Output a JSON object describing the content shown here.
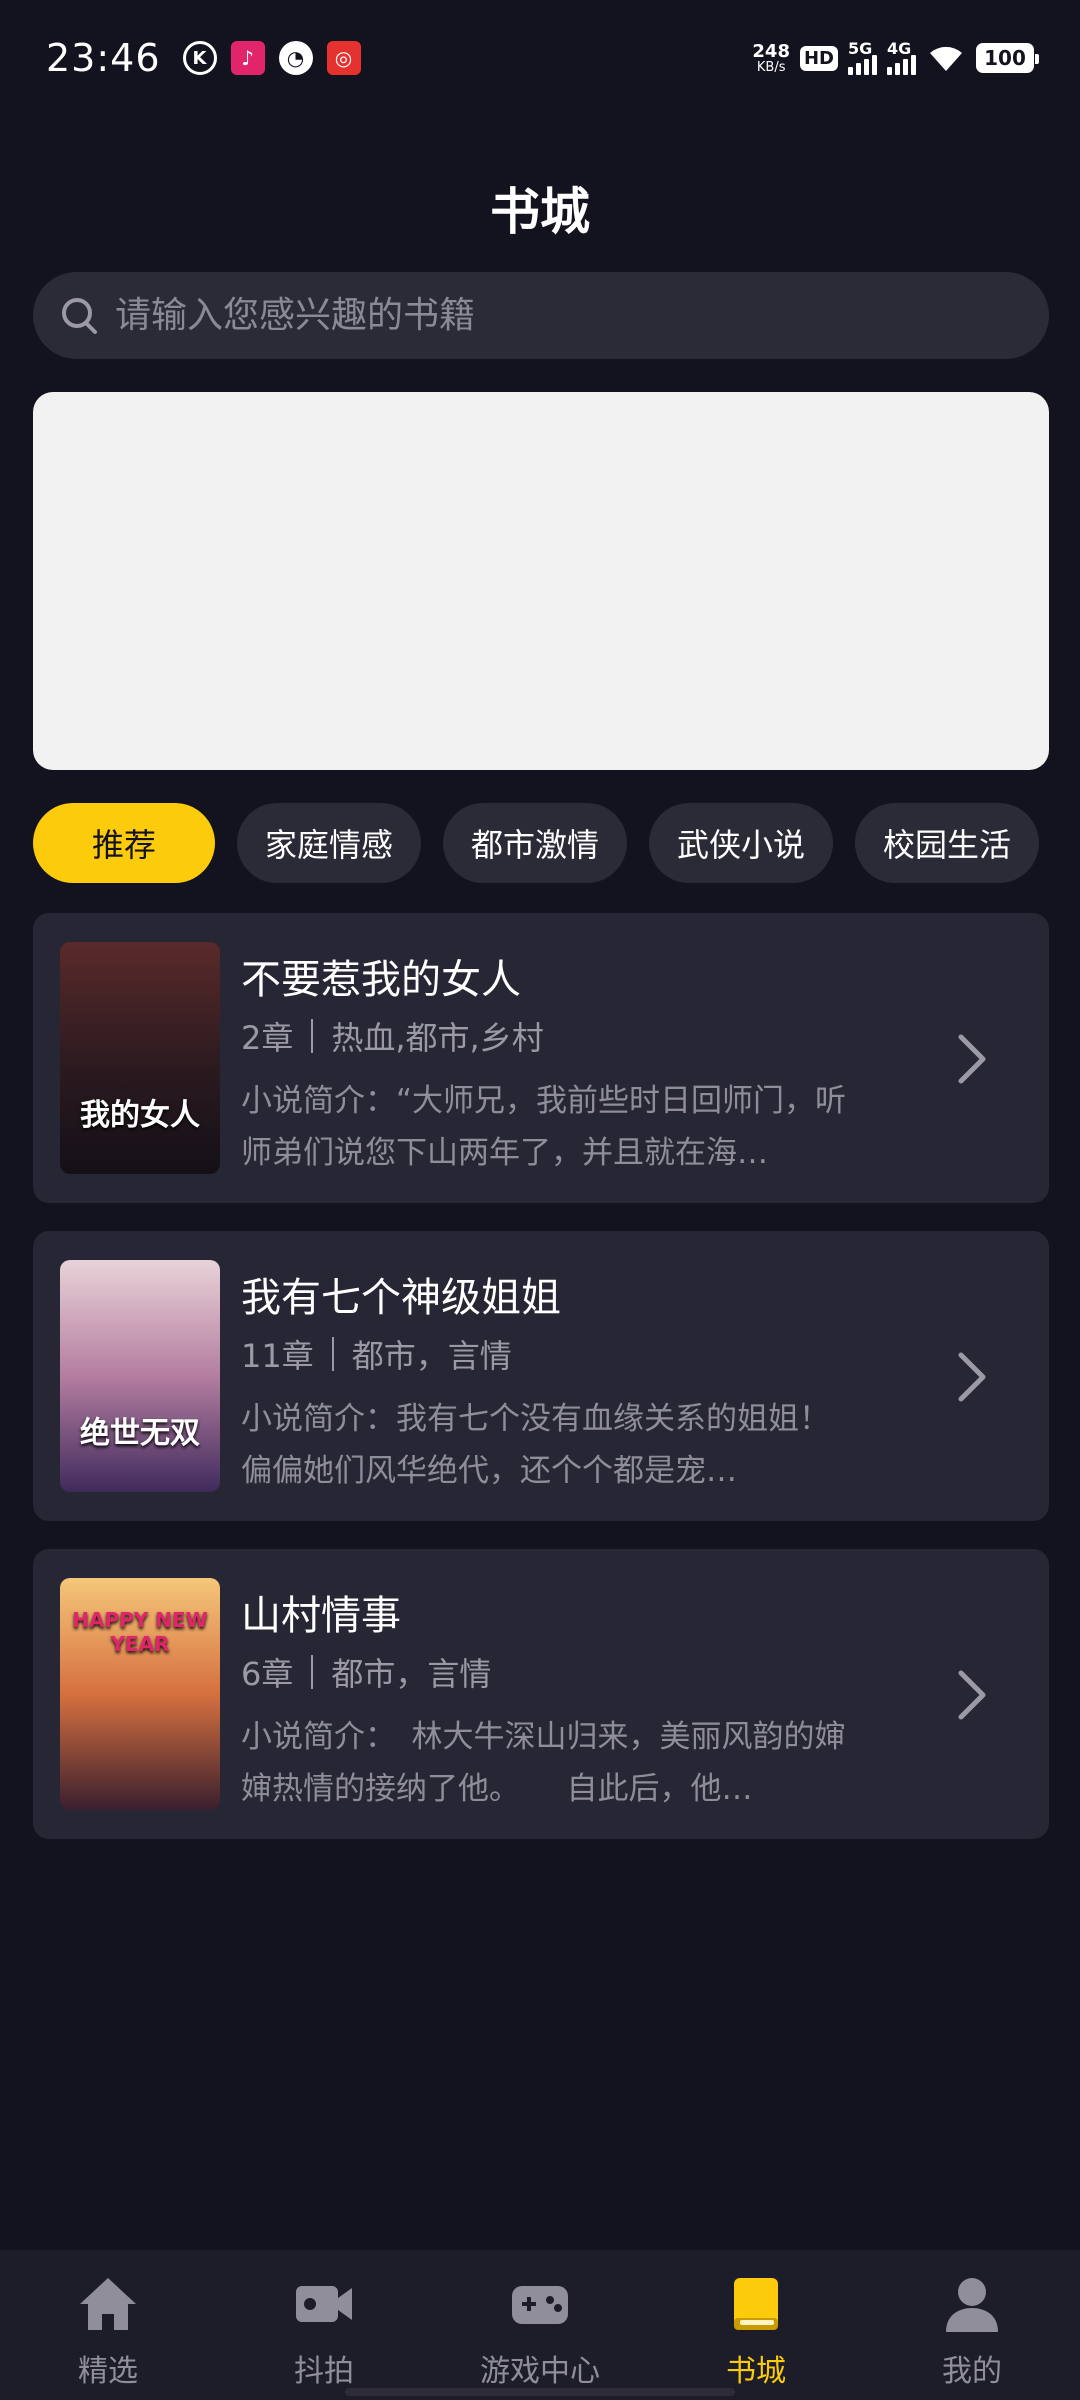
{
  "status_bar": {
    "time": "23:46",
    "net_speed_value": "248",
    "net_speed_unit": "KB/s",
    "hd_label": "HD",
    "signal1_label": "5G",
    "signal2_label": "4G",
    "battery": "100"
  },
  "header": {
    "title": "书城"
  },
  "search": {
    "placeholder": "请输入您感兴趣的书籍"
  },
  "tabs": [
    {
      "label": "推荐",
      "active": true
    },
    {
      "label": "家庭情感",
      "active": false
    },
    {
      "label": "都市激情",
      "active": false
    },
    {
      "label": "武侠小说",
      "active": false
    },
    {
      "label": "校园生活",
      "active": false
    }
  ],
  "books": [
    {
      "title": "不要惹我的女人",
      "chapters": "2章",
      "tags": "热血,都市,乡村",
      "description": "小说简介：“大师兄，我前些时日回师门，听师弟们说您下山两年了，并且就在海…",
      "cover_title": "我的女人",
      "cover_colors": [
        "#5a2a2a",
        "#2a1a1f",
        "#141018"
      ]
    },
    {
      "title": "我有七个神级姐姐",
      "chapters": "11章",
      "tags": "都市，言情",
      "description": "小说简介：我有七个没有血缘关系的姐姐！偏偏她们风华绝代，还个个都是宠…",
      "cover_title": "绝世无双",
      "cover_colors": [
        "#e8d2d8",
        "#b47ea0",
        "#402a5c"
      ]
    },
    {
      "title": "山村情事",
      "chapters": "6章",
      "tags": "都市，言情",
      "description": "小说简介：　林大牛深山归来，美丽风韵的婶婶热情的接纳了他。　　自此后，他…",
      "cover_title": "HAPPY NEW YEAR",
      "cover_colors": [
        "#f5c77a",
        "#d6703f",
        "#3a1f2e"
      ]
    }
  ],
  "bottom_nav": [
    {
      "label": "精选",
      "icon": "home-icon",
      "active": false
    },
    {
      "label": "抖拍",
      "icon": "video-camera-icon",
      "active": false
    },
    {
      "label": "游戏中心",
      "icon": "gamepad-icon",
      "active": false
    },
    {
      "label": "书城",
      "icon": "book-icon",
      "active": true
    },
    {
      "label": "我的",
      "icon": "user-icon",
      "active": false
    }
  ],
  "colors": {
    "background": "#13121f",
    "card": "#272634",
    "accent": "#fccb0b",
    "muted_text": "#9a99a5"
  }
}
